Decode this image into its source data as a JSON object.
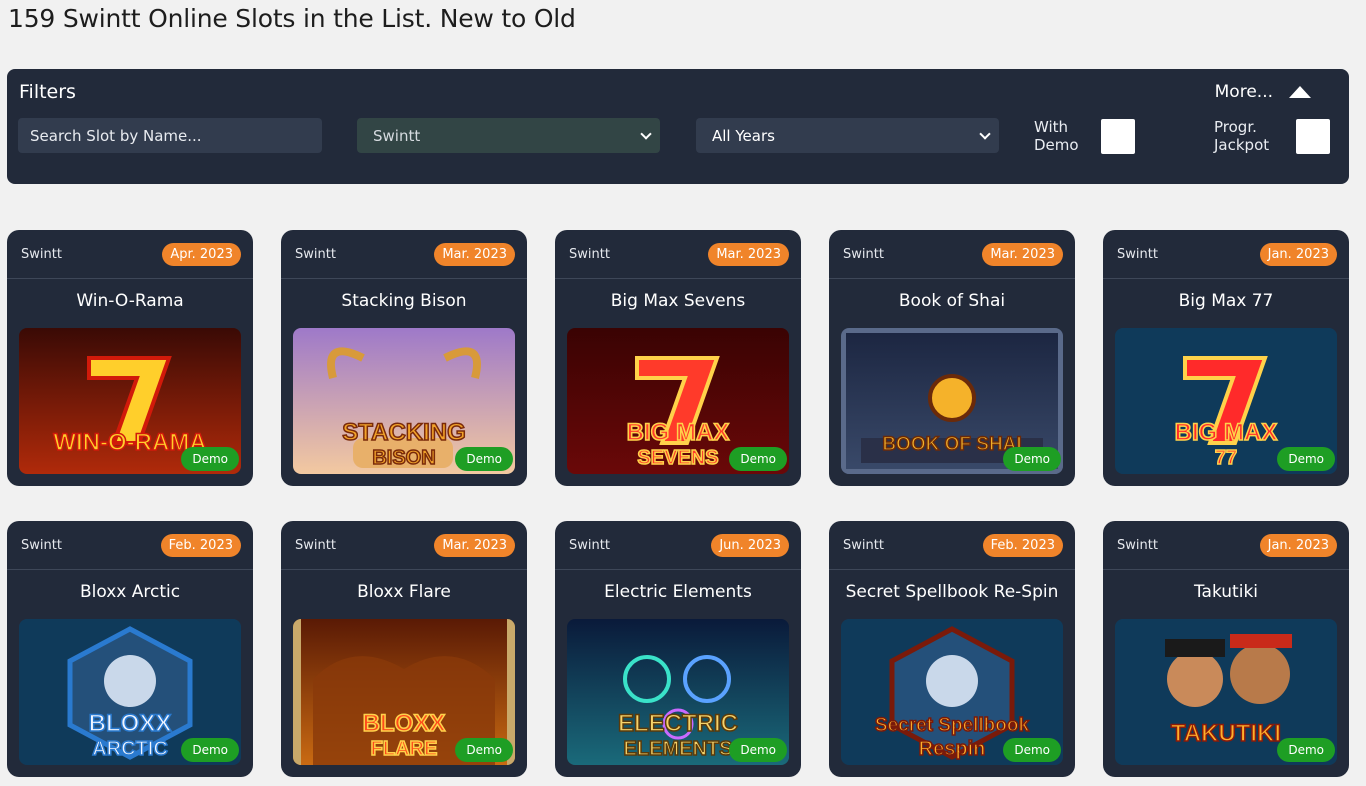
{
  "page": {
    "title": "159 Swintt Online Slots in the List. New to Old"
  },
  "filters": {
    "title": "Filters",
    "more_label": "More...",
    "search_placeholder": "Search Slot by Name...",
    "provider_selected": "Swintt",
    "year_selected": "All Years",
    "with_demo_label_1": "With",
    "with_demo_label_2": "Demo",
    "jackpot_label_1": "Progr.",
    "jackpot_label_2": "Jackpot"
  },
  "colors": {
    "panel": "#222a3a",
    "date_badge": "#f0842a",
    "demo_button": "#1e9e24"
  },
  "slots": [
    {
      "provider": "Swintt",
      "date": "Apr. 2023",
      "title": "Win-O-Rama",
      "demo": "Demo",
      "art": "win-o-rama",
      "logo_line1": "WIN-O-RAMA",
      "logo_line2": ""
    },
    {
      "provider": "Swintt",
      "date": "Mar. 2023",
      "title": "Stacking Bison",
      "demo": "Demo",
      "art": "stacking-bison",
      "logo_line1": "STACKING",
      "logo_line2": "BISON"
    },
    {
      "provider": "Swintt",
      "date": "Mar. 2023",
      "title": "Big Max Sevens",
      "demo": "Demo",
      "art": "big-max-sevens",
      "logo_line1": "BIG MAX",
      "logo_line2": "SEVENS"
    },
    {
      "provider": "Swintt",
      "date": "Mar. 2023",
      "title": "Book of Shai",
      "demo": "Demo",
      "art": "book-of-shai",
      "logo_line1": "BOOK OF SHAI",
      "logo_line2": ""
    },
    {
      "provider": "Swintt",
      "date": "Jan. 2023",
      "title": "Big Max 77",
      "demo": "Demo",
      "art": "big-max-77",
      "logo_line1": "BIG MAX",
      "logo_line2": "77"
    },
    {
      "provider": "Swintt",
      "date": "Feb. 2023",
      "title": "Bloxx Arctic",
      "demo": "Demo",
      "art": "bloxx-arctic",
      "logo_line1": "BLOXX",
      "logo_line2": "ARCTIC"
    },
    {
      "provider": "Swintt",
      "date": "Mar. 2023",
      "title": "Bloxx Flare",
      "demo": "Demo",
      "art": "bloxx-flare",
      "logo_line1": "BLOXX",
      "logo_line2": "FLARE"
    },
    {
      "provider": "Swintt",
      "date": "Jun. 2023",
      "title": "Electric Elements",
      "demo": "Demo",
      "art": "electric-elements",
      "logo_line1": "ELECTRIC",
      "logo_line2": "ELEMENTS"
    },
    {
      "provider": "Swintt",
      "date": "Feb. 2023",
      "title": "Secret Spellbook Re-Spin",
      "demo": "Demo",
      "art": "secret-spellbook",
      "logo_line1": "Secret Spellbook",
      "logo_line2": "Respin"
    },
    {
      "provider": "Swintt",
      "date": "Jan. 2023",
      "title": "Takutiki",
      "demo": "Demo",
      "art": "takutiki",
      "logo_line1": "TAKUTIKI",
      "logo_line2": ""
    }
  ]
}
